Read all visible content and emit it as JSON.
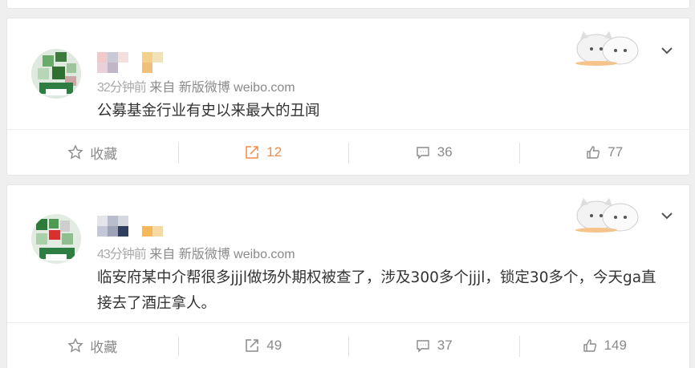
{
  "posts": [
    {
      "time": "32分钟前",
      "source": "来自 新版微博 weibo.com",
      "content": "公募基金行业有史以来最大的丑闻",
      "actions": {
        "favorite": "收藏",
        "repost": "12",
        "comment": "36",
        "like": "77"
      },
      "repost_active": true
    },
    {
      "time": "43分钟前",
      "source": "来自 新版微博 weibo.com",
      "content": "临安府某中介帮很多jjjl做场外期权被查了，涉及300多个jjjl，锁定30多个，今天ga直接去了酒庄拿人。",
      "actions": {
        "favorite": "收藏",
        "repost": "49",
        "comment": "37",
        "like": "149"
      },
      "repost_active": false
    }
  ],
  "colors": {
    "accent": "#f08a4a",
    "muted": "#8a8a8a",
    "text": "#333333"
  },
  "icons": {
    "favorite": "star-outline-icon",
    "repost": "share-arrow-icon",
    "comment": "comment-bubble-icon",
    "like": "thumbs-up-icon",
    "menu": "chevron-down-icon"
  }
}
